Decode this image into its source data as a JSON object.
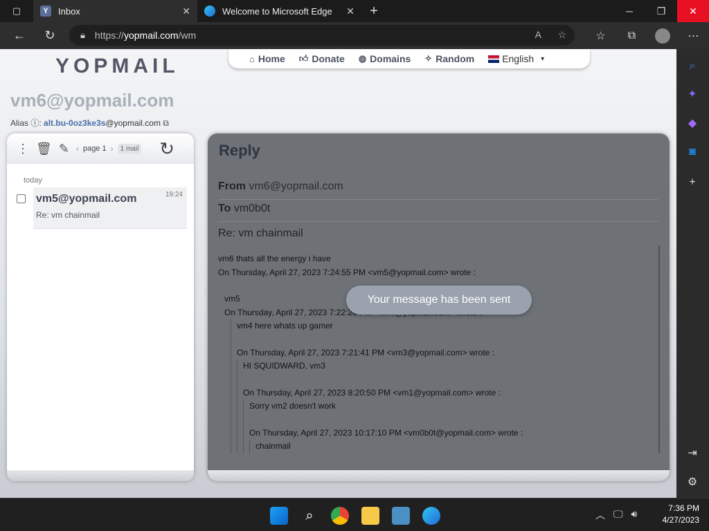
{
  "browser": {
    "tabs": [
      {
        "title": "Inbox",
        "favicon": "Y",
        "active": true
      },
      {
        "title": "Welcome to Microsoft Edge",
        "favicon": "e",
        "active": false
      }
    ],
    "address": {
      "prefix": "https://",
      "host": "yopmail.com",
      "path": "/wm"
    }
  },
  "site": {
    "logo": "YOPMAIL",
    "nav": [
      {
        "label": "Home",
        "icon": "home-icon"
      },
      {
        "label": "Donate",
        "icon": "thumbs-up-icon"
      },
      {
        "label": "Domains",
        "icon": "globe-icon"
      },
      {
        "label": "Random",
        "icon": "magic-wand-icon"
      }
    ],
    "language": "English"
  },
  "account": {
    "email": "vm6@yopmail.com",
    "alias_label": "Alias",
    "alias_local": "alt.bu-0oz3ke3s",
    "alias_domain": "@yopmail.com"
  },
  "inbox": {
    "page_label": "page 1",
    "mail_count": "1 mail",
    "day_label": "today",
    "messages": [
      {
        "from": "vm5@yopmail.com",
        "subject": "Re: vm chainmail",
        "time": "19:24"
      }
    ]
  },
  "reply": {
    "title": "Reply",
    "from_label": "From",
    "from": "vm6@yopmail.com",
    "to_label": "To",
    "to": "vm0b0t",
    "subject": "Re: vm chainmail",
    "body": {
      "line1": "vm6 thats all the energy i have",
      "quote1_header": "On Thursday, April 27, 2023 7:24:55 PM <vm5@yopmail.com> wrote :",
      "quote1_text": "vm5",
      "quote2_header": "On Thursday, April 27, 2023 7:22:20 PM <vm4@yopmail.com> wrote :",
      "quote2_text": "vm4 here whats up gamer",
      "quote3_header": "On Thursday, April 27, 2023 7:21:41 PM <vm3@yopmail.com> wrote :",
      "quote3_text": "HI SQUIDWARD, vm3",
      "quote4_header": "On Thursday, April 27, 2023 8:20:50 PM <vm1@yopmail.com> wrote :",
      "quote4_text": "Sorry vm2 doesn't work",
      "quote5_header": "On Thursday, April 27, 2023 10:17:10 PM <vm0b0t@yopmail.com> wrote :",
      "quote5_text": "chainmail"
    }
  },
  "toast": "Your message has been sent",
  "taskbar": {
    "time": "7:36 PM",
    "date": "4/27/2023"
  }
}
